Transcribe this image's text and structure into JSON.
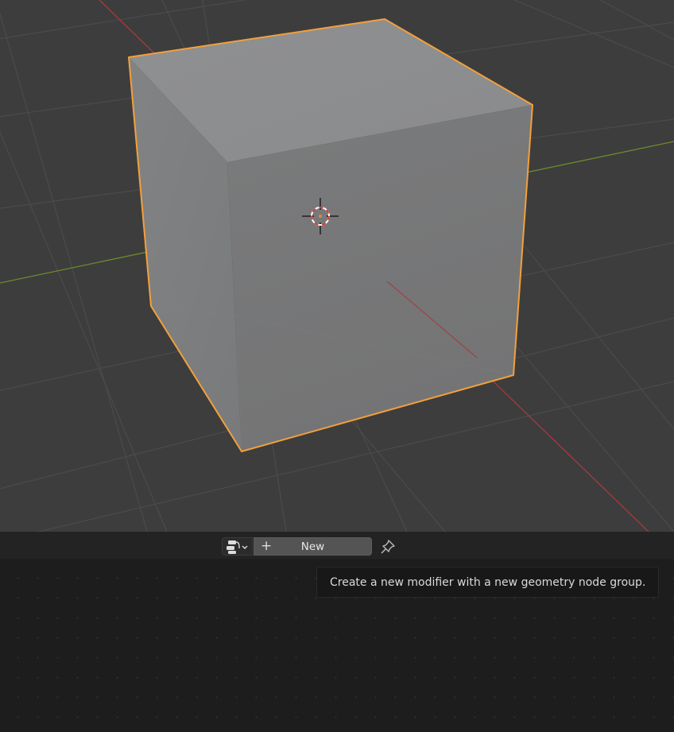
{
  "viewport": {
    "object": "cube",
    "selected": true,
    "colors": {
      "background": "#3d3d3d",
      "grid": "#4d4d4d",
      "x_axis": "#a43a3f",
      "y_axis": "#6c8b2b",
      "selection_outline": "#f3a03b",
      "cube_top": "#8c8d8f",
      "cube_left": "#7e7f80",
      "cube_front": "#7a7a7a"
    }
  },
  "node_editor": {
    "editor_type_icon": "geometry-nodes-editor-icon",
    "new_button_label": "New",
    "new_button_icon": "plus-icon",
    "pin_icon": "pin-icon",
    "tooltip": "Create a new modifier with a new geometry node group."
  }
}
